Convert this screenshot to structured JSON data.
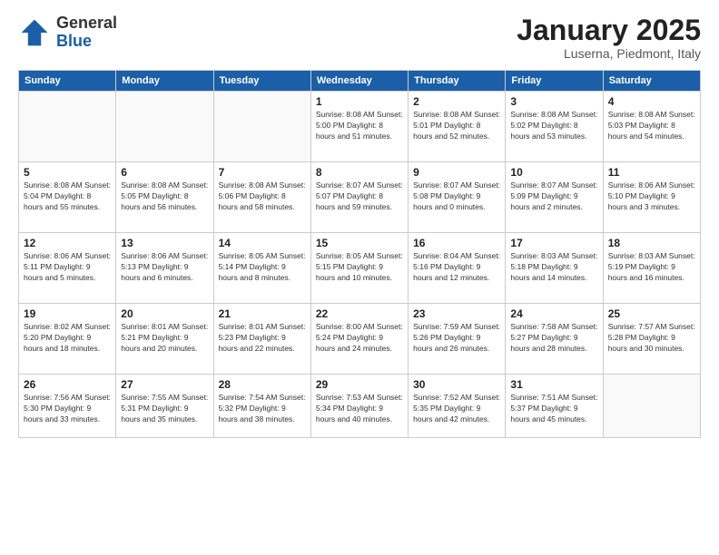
{
  "logo": {
    "general": "General",
    "blue": "Blue"
  },
  "header": {
    "month": "January 2025",
    "location": "Luserna, Piedmont, Italy"
  },
  "weekdays": [
    "Sunday",
    "Monday",
    "Tuesday",
    "Wednesday",
    "Thursday",
    "Friday",
    "Saturday"
  ],
  "weeks": [
    [
      {
        "day": "",
        "info": ""
      },
      {
        "day": "",
        "info": ""
      },
      {
        "day": "",
        "info": ""
      },
      {
        "day": "1",
        "info": "Sunrise: 8:08 AM\nSunset: 5:00 PM\nDaylight: 8 hours\nand 51 minutes."
      },
      {
        "day": "2",
        "info": "Sunrise: 8:08 AM\nSunset: 5:01 PM\nDaylight: 8 hours\nand 52 minutes."
      },
      {
        "day": "3",
        "info": "Sunrise: 8:08 AM\nSunset: 5:02 PM\nDaylight: 8 hours\nand 53 minutes."
      },
      {
        "day": "4",
        "info": "Sunrise: 8:08 AM\nSunset: 5:03 PM\nDaylight: 8 hours\nand 54 minutes."
      }
    ],
    [
      {
        "day": "5",
        "info": "Sunrise: 8:08 AM\nSunset: 5:04 PM\nDaylight: 8 hours\nand 55 minutes."
      },
      {
        "day": "6",
        "info": "Sunrise: 8:08 AM\nSunset: 5:05 PM\nDaylight: 8 hours\nand 56 minutes."
      },
      {
        "day": "7",
        "info": "Sunrise: 8:08 AM\nSunset: 5:06 PM\nDaylight: 8 hours\nand 58 minutes."
      },
      {
        "day": "8",
        "info": "Sunrise: 8:07 AM\nSunset: 5:07 PM\nDaylight: 8 hours\nand 59 minutes."
      },
      {
        "day": "9",
        "info": "Sunrise: 8:07 AM\nSunset: 5:08 PM\nDaylight: 9 hours\nand 0 minutes."
      },
      {
        "day": "10",
        "info": "Sunrise: 8:07 AM\nSunset: 5:09 PM\nDaylight: 9 hours\nand 2 minutes."
      },
      {
        "day": "11",
        "info": "Sunrise: 8:06 AM\nSunset: 5:10 PM\nDaylight: 9 hours\nand 3 minutes."
      }
    ],
    [
      {
        "day": "12",
        "info": "Sunrise: 8:06 AM\nSunset: 5:11 PM\nDaylight: 9 hours\nand 5 minutes."
      },
      {
        "day": "13",
        "info": "Sunrise: 8:06 AM\nSunset: 5:13 PM\nDaylight: 9 hours\nand 6 minutes."
      },
      {
        "day": "14",
        "info": "Sunrise: 8:05 AM\nSunset: 5:14 PM\nDaylight: 9 hours\nand 8 minutes."
      },
      {
        "day": "15",
        "info": "Sunrise: 8:05 AM\nSunset: 5:15 PM\nDaylight: 9 hours\nand 10 minutes."
      },
      {
        "day": "16",
        "info": "Sunrise: 8:04 AM\nSunset: 5:16 PM\nDaylight: 9 hours\nand 12 minutes."
      },
      {
        "day": "17",
        "info": "Sunrise: 8:03 AM\nSunset: 5:18 PM\nDaylight: 9 hours\nand 14 minutes."
      },
      {
        "day": "18",
        "info": "Sunrise: 8:03 AM\nSunset: 5:19 PM\nDaylight: 9 hours\nand 16 minutes."
      }
    ],
    [
      {
        "day": "19",
        "info": "Sunrise: 8:02 AM\nSunset: 5:20 PM\nDaylight: 9 hours\nand 18 minutes."
      },
      {
        "day": "20",
        "info": "Sunrise: 8:01 AM\nSunset: 5:21 PM\nDaylight: 9 hours\nand 20 minutes."
      },
      {
        "day": "21",
        "info": "Sunrise: 8:01 AM\nSunset: 5:23 PM\nDaylight: 9 hours\nand 22 minutes."
      },
      {
        "day": "22",
        "info": "Sunrise: 8:00 AM\nSunset: 5:24 PM\nDaylight: 9 hours\nand 24 minutes."
      },
      {
        "day": "23",
        "info": "Sunrise: 7:59 AM\nSunset: 5:26 PM\nDaylight: 9 hours\nand 26 minutes."
      },
      {
        "day": "24",
        "info": "Sunrise: 7:58 AM\nSunset: 5:27 PM\nDaylight: 9 hours\nand 28 minutes."
      },
      {
        "day": "25",
        "info": "Sunrise: 7:57 AM\nSunset: 5:28 PM\nDaylight: 9 hours\nand 30 minutes."
      }
    ],
    [
      {
        "day": "26",
        "info": "Sunrise: 7:56 AM\nSunset: 5:30 PM\nDaylight: 9 hours\nand 33 minutes."
      },
      {
        "day": "27",
        "info": "Sunrise: 7:55 AM\nSunset: 5:31 PM\nDaylight: 9 hours\nand 35 minutes."
      },
      {
        "day": "28",
        "info": "Sunrise: 7:54 AM\nSunset: 5:32 PM\nDaylight: 9 hours\nand 38 minutes."
      },
      {
        "day": "29",
        "info": "Sunrise: 7:53 AM\nSunset: 5:34 PM\nDaylight: 9 hours\nand 40 minutes."
      },
      {
        "day": "30",
        "info": "Sunrise: 7:52 AM\nSunset: 5:35 PM\nDaylight: 9 hours\nand 42 minutes."
      },
      {
        "day": "31",
        "info": "Sunrise: 7:51 AM\nSunset: 5:37 PM\nDaylight: 9 hours\nand 45 minutes."
      },
      {
        "day": "",
        "info": ""
      }
    ]
  ]
}
